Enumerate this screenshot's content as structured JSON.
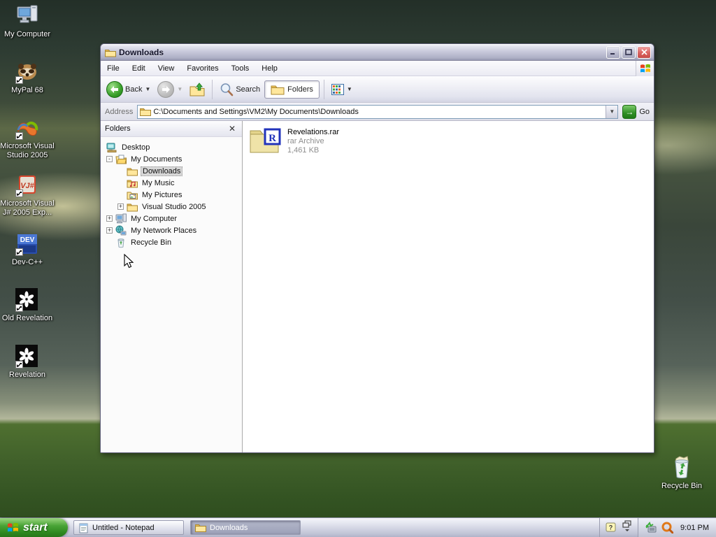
{
  "desktop": {
    "icons": [
      {
        "label": "My Computer"
      },
      {
        "label": "MyPal 68"
      },
      {
        "label": "Microsoft Visual Studio 2005"
      },
      {
        "label": "Microsoft Visual J# 2005 Exp..."
      },
      {
        "label": "Dev-C++"
      },
      {
        "label": "Old Revelation"
      },
      {
        "label": "Revelation"
      }
    ],
    "recycle_bin_label": "Recycle Bin"
  },
  "window": {
    "title": "Downloads",
    "menu_items": [
      "File",
      "Edit",
      "View",
      "Favorites",
      "Tools",
      "Help"
    ],
    "toolbar": {
      "back_label": "Back",
      "search_label": "Search",
      "folders_label": "Folders"
    },
    "address": {
      "label": "Address",
      "value": "C:\\Documents and Settings\\VM2\\My Documents\\Downloads",
      "go_label": "Go"
    },
    "folders_pane": {
      "header": "Folders",
      "tree": [
        {
          "label": "Desktop",
          "expander": ""
        },
        {
          "label": "My Documents",
          "expander": "-"
        },
        {
          "label": "Downloads",
          "expander": ""
        },
        {
          "label": "My Music",
          "expander": ""
        },
        {
          "label": "My Pictures",
          "expander": ""
        },
        {
          "label": "Visual Studio 2005",
          "expander": "+"
        },
        {
          "label": "My Computer",
          "expander": "+"
        },
        {
          "label": "My Network Places",
          "expander": "+"
        },
        {
          "label": "Recycle Bin",
          "expander": ""
        }
      ]
    },
    "file": {
      "name": "Revelations.rar",
      "type": "rar Archive",
      "size": "1,461 KB"
    }
  },
  "taskbar": {
    "start_label": "start",
    "buttons": [
      {
        "label": "Untitled - Notepad"
      },
      {
        "label": "Downloads"
      }
    ],
    "clock": "9:01 PM"
  }
}
